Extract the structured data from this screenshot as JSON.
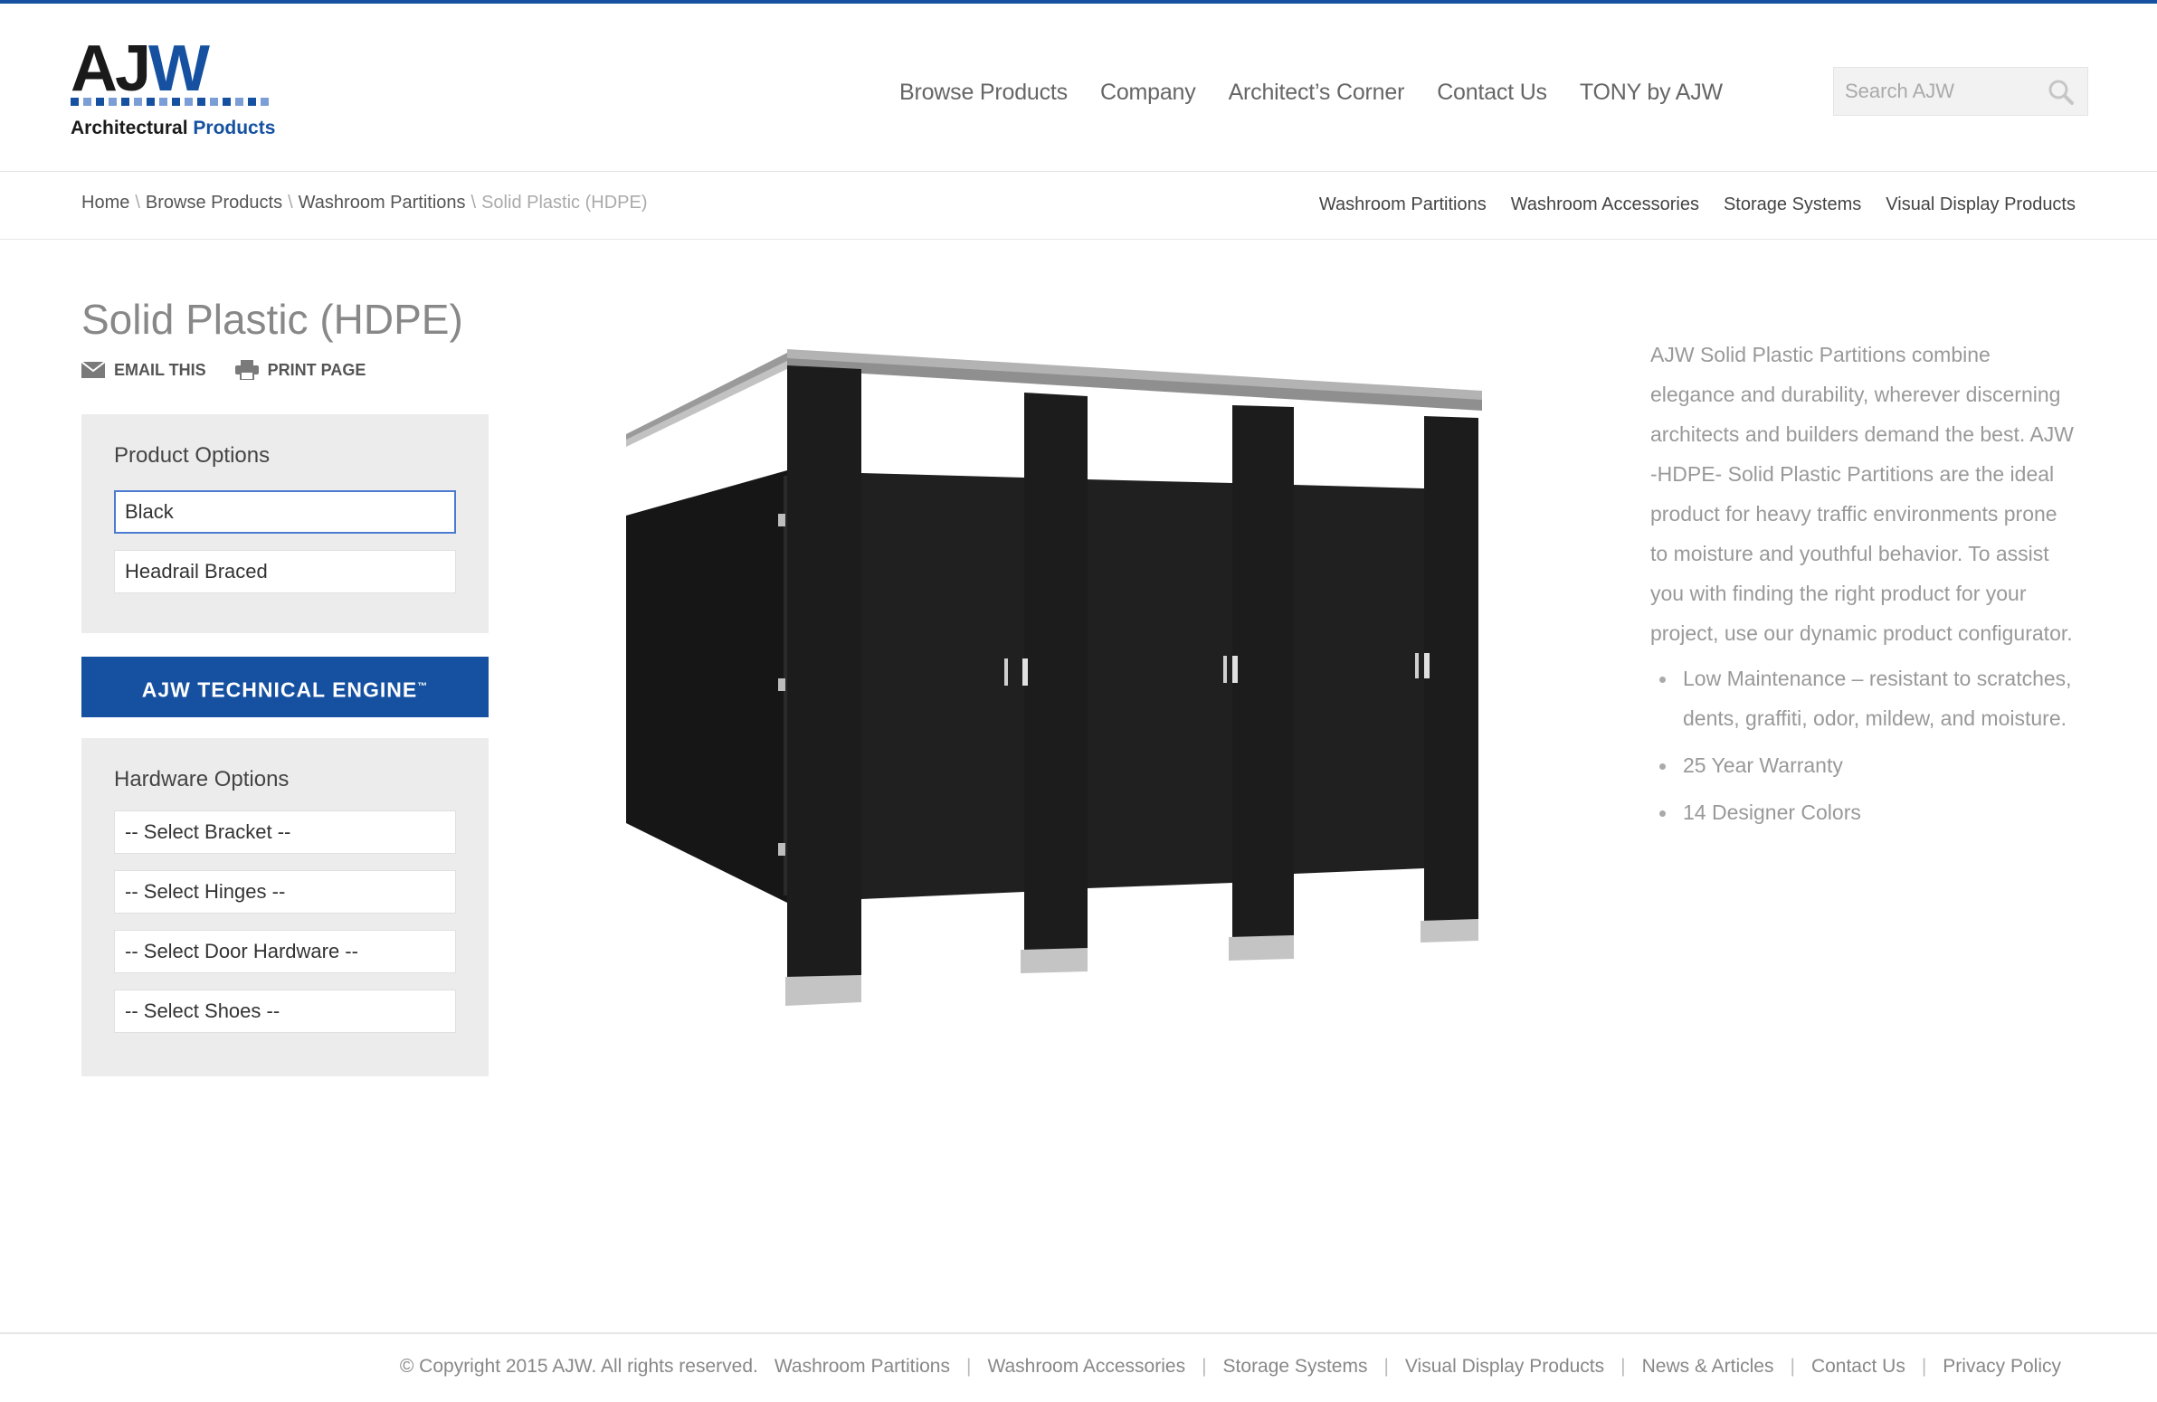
{
  "brand": {
    "logo_text": "AJW",
    "logo_sub_1": "Architectural",
    "logo_sub_2": "Products",
    "accent_color": "#1551a0"
  },
  "header": {
    "nav": [
      "Browse Products",
      "Company",
      "Architect’s Corner",
      "Contact Us",
      "TONY by AJW"
    ],
    "search_placeholder": "Search AJW"
  },
  "breadcrumb": {
    "items": [
      "Home",
      "Browse Products",
      "Washroom Partitions"
    ],
    "current": "Solid Plastic (HDPE)"
  },
  "category_nav": [
    "Washroom Partitions",
    "Washroom Accessories",
    "Storage Systems",
    "Visual Display Products"
  ],
  "product": {
    "title": "Solid Plastic (HDPE)",
    "email_label": "EMAIL THIS",
    "print_label": "PRINT PAGE",
    "options_title": "Product Options",
    "color_value": "Black",
    "bracing_value": "Headrail Braced",
    "tech_button": "AJW TECHNICAL ENGINE",
    "tech_tm": "™",
    "hardware_title": "Hardware Options",
    "hardware_selects": [
      "-- Select Bracket --",
      "-- Select Hinges --",
      "-- Select Door Hardware --",
      "-- Select Shoes --"
    ],
    "image_alt": "Black solid plastic washroom partitions, headrail braced"
  },
  "description": {
    "paragraph": "AJW Solid Plastic Partitions combine elegance and durability, wherever discerning architects and builders demand the best. AJW -HDPE- Solid Plastic Partitions are the ideal product for heavy traffic environments prone to moisture and youthful behavior. To assist you with finding the right product for your project, use our dynamic product configurator.",
    "bullets": [
      "Low Maintenance – resistant to scratches, dents, graffiti, odor, mildew, and moisture.",
      "25 Year Warranty",
      "14 Designer Colors"
    ]
  },
  "footer": {
    "copyright": "© Copyright 2015 AJW. All rights reserved.",
    "links": [
      "Washroom Partitions",
      "Washroom Accessories",
      "Storage Systems",
      "Visual Display Products",
      "News & Articles",
      "Contact Us",
      "Privacy Policy"
    ]
  }
}
